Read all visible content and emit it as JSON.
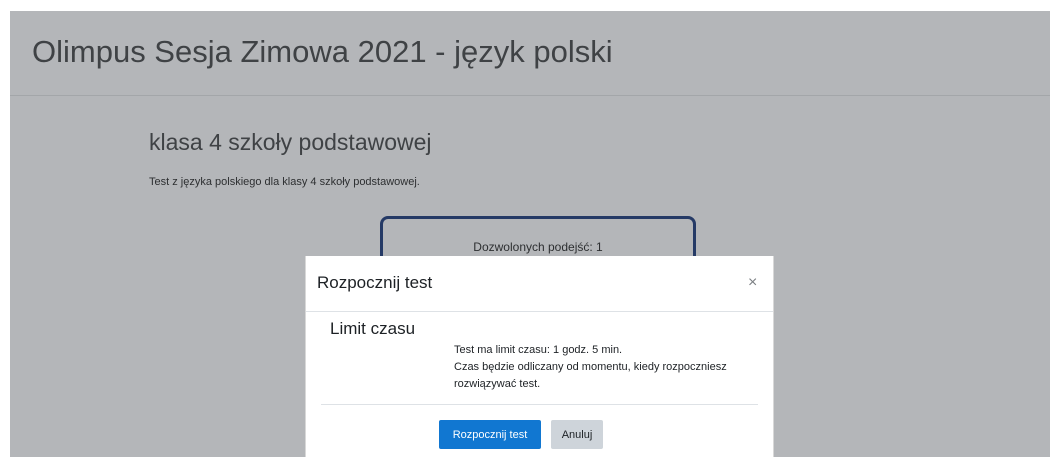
{
  "course": {
    "title": "Olimpus Sesja Zimowa 2021 - język polski"
  },
  "quiz": {
    "title": "klasa 4 szkoły podstawowej",
    "intro": "Test z języka polskiego dla klasy 4 szkoły podstawowej.",
    "attempts_allowed": "Dozwolonych podejść: 1"
  },
  "modal": {
    "title": "Rozpocznij test",
    "close_symbol": "×",
    "section_heading": "Limit czasu",
    "lines": [
      "Test ma limit czasu: 1 godz. 5 min.",
      "Czas będzie odliczany od momentu, kiedy rozpoczniesz",
      "rozwiązywać test."
    ],
    "start_button": "Rozpocznij test",
    "cancel_button": "Anuluj"
  },
  "colors": {
    "backdrop": "#b4b6b9",
    "primary": "#1177d1",
    "secondary": "#ced4da",
    "info_box_border": "#253a66"
  },
  "icons": {
    "close": "close-icon"
  }
}
